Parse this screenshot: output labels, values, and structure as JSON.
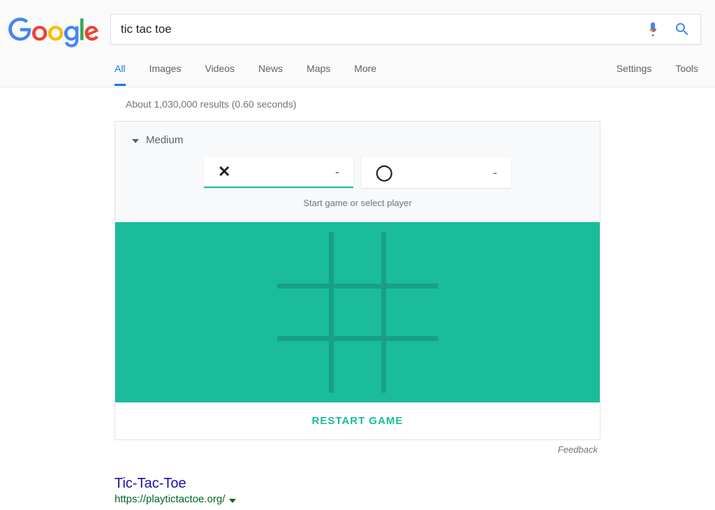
{
  "search": {
    "query": "tic tac toe"
  },
  "tabs": {
    "items": [
      "All",
      "Images",
      "Videos",
      "News",
      "Maps",
      "More"
    ],
    "active_index": 0,
    "right": [
      "Settings",
      "Tools"
    ]
  },
  "stats": "About 1,030,000 results (0.60 seconds)",
  "game": {
    "difficulty": "Medium",
    "player_x": {
      "symbol": "✕",
      "score": "-"
    },
    "player_o": {
      "symbol": "◯",
      "score": "-"
    },
    "hint": "Start game or select player",
    "restart_label": "RESTART GAME",
    "board_color": "#1abc9c",
    "board": [
      [
        "",
        "",
        ""
      ],
      [
        "",
        "",
        ""
      ],
      [
        "",
        "",
        ""
      ]
    ]
  },
  "feedback_label": "Feedback",
  "result": {
    "title": "Tic-Tac-Toe",
    "url": "https://playtictactoe.org/"
  }
}
